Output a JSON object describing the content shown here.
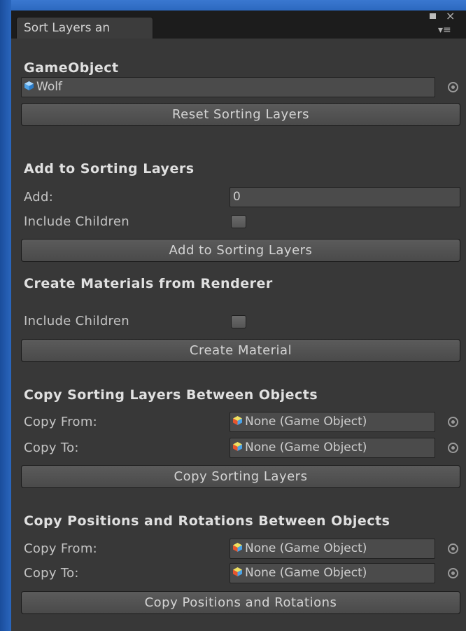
{
  "window": {
    "tab_title": "Sort Layers an",
    "close_glyph": "×",
    "menu_glyph": "▾≡"
  },
  "gameobject": {
    "heading": "GameObject",
    "value": "Wolf",
    "reset_button": "Reset Sorting Layers"
  },
  "add_section": {
    "heading": "Add to Sorting Layers",
    "add_label": "Add:",
    "add_value": "0",
    "include_children_label": "Include Children",
    "include_children_checked": false,
    "button": "Add to Sorting Layers"
  },
  "materials_section": {
    "heading": "Create Materials from Renderer",
    "include_children_label": "Include Children",
    "include_children_checked": false,
    "button": "Create Material"
  },
  "copy_layers_section": {
    "heading": "Copy Sorting Layers Between Objects",
    "copy_from_label": "Copy From:",
    "copy_from_value": "None (Game Object)",
    "copy_to_label": "Copy To:",
    "copy_to_value": "None (Game Object)",
    "button": "Copy Sorting Layers"
  },
  "copy_positions_section": {
    "heading": "Copy Positions and Rotations Between Objects",
    "copy_from_label": "Copy From:",
    "copy_from_value": "None (Game Object)",
    "copy_to_label": "Copy To:",
    "copy_to_value": "None (Game Object)",
    "button": "Copy Positions and Rotations"
  },
  "icons": {
    "gameobject_cube": "blue-cube-icon",
    "none_cube": "multicolor-cube-icon",
    "picker": "object-picker-icon",
    "maximize": "maximize-icon",
    "close": "close-icon",
    "menu": "tab-menu-icon"
  },
  "colors": {
    "panel_background": "#383838",
    "field_background": "#4b4b4b",
    "desktop_blue": "#1f55a8"
  }
}
